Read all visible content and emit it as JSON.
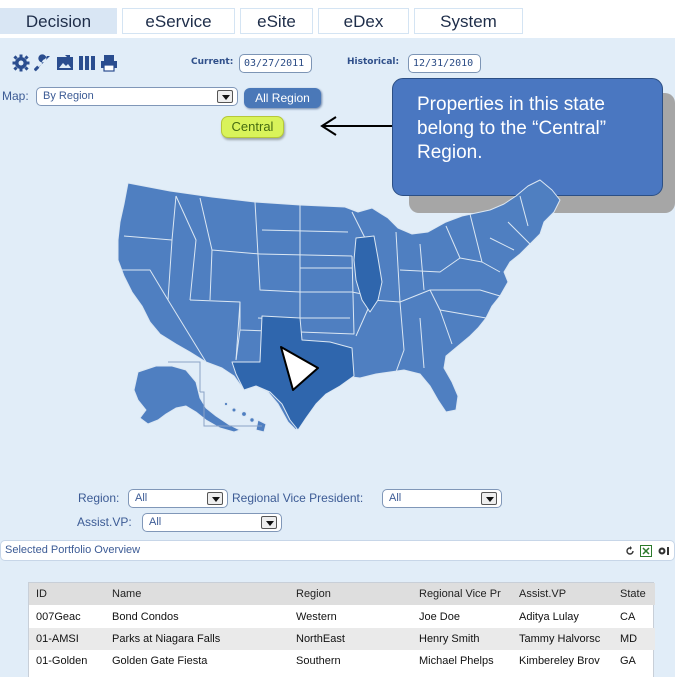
{
  "tabs": [
    {
      "label": "Decision",
      "active": true
    },
    {
      "label": "eService",
      "active": false
    },
    {
      "label": "eSite",
      "active": false
    },
    {
      "label": "eDex",
      "active": false
    },
    {
      "label": "System",
      "active": false
    }
  ],
  "toolbar": {
    "icons": [
      "gear-icon",
      "wrench-icon",
      "export-image-icon",
      "columns-icon",
      "print-icon"
    ],
    "current_label": "Current:",
    "current_value": "03/27/2011",
    "historical_label": "Historical:",
    "historical_value": "12/31/2010"
  },
  "map_controls": {
    "map_label": "Map:",
    "map_select_value": "By Region",
    "all_region_label": "All Region",
    "selected_region": "Central"
  },
  "callout": {
    "text": "Properties in this state belong to the “Central” Region."
  },
  "map": {
    "selected_state_color": "#2f66ad",
    "state_color": "#4f7fc1",
    "highlighted_states": [
      "TX",
      "IL"
    ]
  },
  "filters": {
    "region_label": "Region:",
    "region_value": "All",
    "rvp_label": "Regional Vice President:",
    "rvp_value": "All",
    "assist_label": "Assist.VP:",
    "assist_value": "All"
  },
  "portfolio": {
    "title": "Selected Portfolio Overview",
    "icons": [
      "refresh-icon",
      "excel-icon",
      "settings-icon"
    ]
  },
  "table": {
    "columns": [
      "ID",
      "Name",
      "Region",
      "Regional Vice Pr",
      "Assist.VP",
      "State"
    ],
    "rows": [
      [
        "007Geac",
        "Bond Condos",
        "Western",
        "Joe Doe",
        "Aditya Lulay",
        "CA"
      ],
      [
        "01-AMSI",
        "Parks at Niagara Falls",
        "NorthEast",
        "Henry Smith",
        "Tammy Halvorsc",
        "MD"
      ],
      [
        "01-Golden",
        "Golden Gate Fiesta",
        "Southern",
        "Michael Phelps",
        "Kimbereley Brov",
        "GA"
      ]
    ]
  },
  "colors": {
    "panel_bg": "#e1edf8",
    "accent": "#4a78b8",
    "central_pill": "#d9f35a"
  }
}
